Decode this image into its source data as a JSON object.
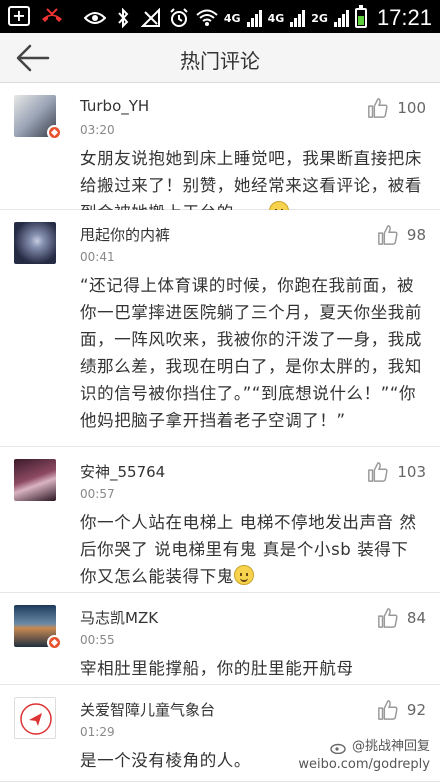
{
  "statusbar": {
    "network1": "4G",
    "network2": "4G",
    "network3": "2G",
    "time": "17:21",
    "battery_level": 0.55,
    "battery_color": "#5ecf3a",
    "icons": [
      "add-icon",
      "missed-call-icon",
      "eye-icon",
      "bluetooth-icon",
      "no-signal-icon",
      "alarm-icon",
      "wifi-icon",
      "signal-icon",
      "battery-icon"
    ]
  },
  "header": {
    "title": "热门评论",
    "back_icon": "back-arrow-icon"
  },
  "comments": [
    {
      "name": "Turbo_YH",
      "time": "03:20",
      "likes": "100",
      "text": "女朋友说抱她到床上睡觉吧，我果断直接把床给搬过来了！别赞，她经常来这看评论，被看到会被她搬上天台的。。。",
      "emoji": "smile-emoji",
      "verified": true
    },
    {
      "name": "甩起你的内裤",
      "time": "00:41",
      "likes": "98",
      "text": "“还记得上体育课的时候，你跑在我前面，被你一巴掌摔进医院躺了三个月，夏天你坐我前面，一阵风吹来，我被你的汗泼了一身，我成绩那么差，我现在明白了，是你太胖的，我知识的信号被你挡住了。”“到底想说什么！”“你他妈把脑子拿开挡着老子空调了！”",
      "verified": false
    },
    {
      "name": "安神_55764",
      "time": "00:57",
      "likes": "103",
      "text": "你一个人站在电梯上 电梯不停地发出声音 然后你哭了 说电梯里有鬼 真是个小sb 装得下你又怎么能装得下鬼",
      "emoji": "smirk-emoji",
      "verified": false
    },
    {
      "name": "马志凯MZK",
      "time": "00:55",
      "likes": "84",
      "text": "宰相肚里能撑船，你的肚里能开航母",
      "verified": true
    },
    {
      "name": "关爱智障儿童气象台",
      "time": "01:29",
      "likes": "92",
      "text": "是一个没有棱角的人。",
      "verified": false
    }
  ],
  "watermark": {
    "line1": "@挑战神回复",
    "line2": "weibo.com/godreply"
  },
  "colors": {
    "like_icon": "#999999",
    "badge": "#e8532e",
    "background": "#f4f4f4"
  }
}
